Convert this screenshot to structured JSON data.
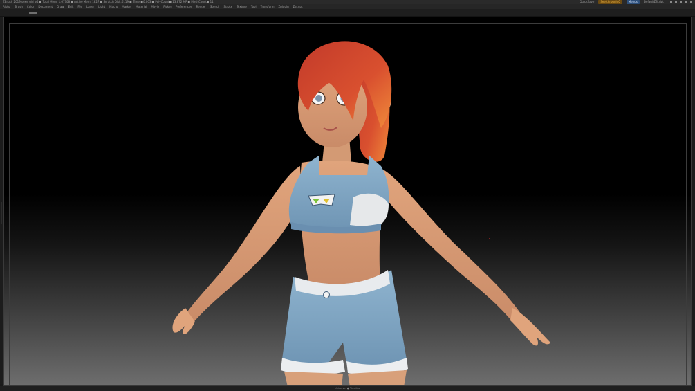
{
  "titlebar": {
    "title": "ZBrush 2019  sexy_girl_v4 ● Total Mem: 1.67708 ● Active Mem: 1827 ● Scratch Disk:6119 ● Timer●0.003 ● PolyCount● 13.872 MP ● MeshCount● 11",
    "quicksave": "QuickSave",
    "see_through": "See-through  0",
    "menus_btn": "Menus",
    "default_script": "DefaultZScript"
  },
  "menubar": [
    "Alpha",
    "Brush",
    "Color",
    "Document",
    "Draw",
    "Edit",
    "File",
    "Layer",
    "Light",
    "Macro",
    "Marker",
    "Material",
    "Movie",
    "Picker",
    "Preferences",
    "Render",
    "Stencil",
    "Stroke",
    "Texture",
    "Tool",
    "Transform",
    "Zplugin",
    "Zscript"
  ],
  "statusbar": {
    "text": "Universe: ● Timeline"
  }
}
